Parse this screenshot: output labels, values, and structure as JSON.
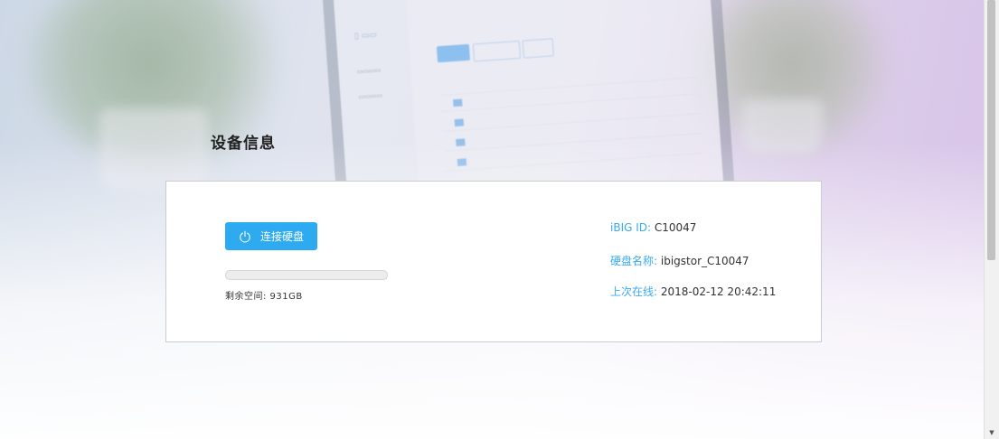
{
  "page": {
    "title": "设备信息"
  },
  "device": {
    "connect_button_label": "连接硬盘",
    "storage_used_percent": 0,
    "free_space_label": "剩余空间:",
    "free_space_value": "931GB",
    "free_space_text": "剩余空间: 931GB",
    "id_label": "iBIG ID:",
    "id_value": "C10047",
    "name_label": "硬盘名称:",
    "name_value": "ibigstor_C10047",
    "last_online_label": "上次在线:",
    "last_online_value": "2018-02-12 20:42:11"
  },
  "colors": {
    "accent": "#2eaaf0",
    "label": "#3aaaf0",
    "text": "#333333"
  },
  "icons": {
    "connect": "power-icon",
    "scroll_down": "scroll-down-arrow-icon"
  }
}
